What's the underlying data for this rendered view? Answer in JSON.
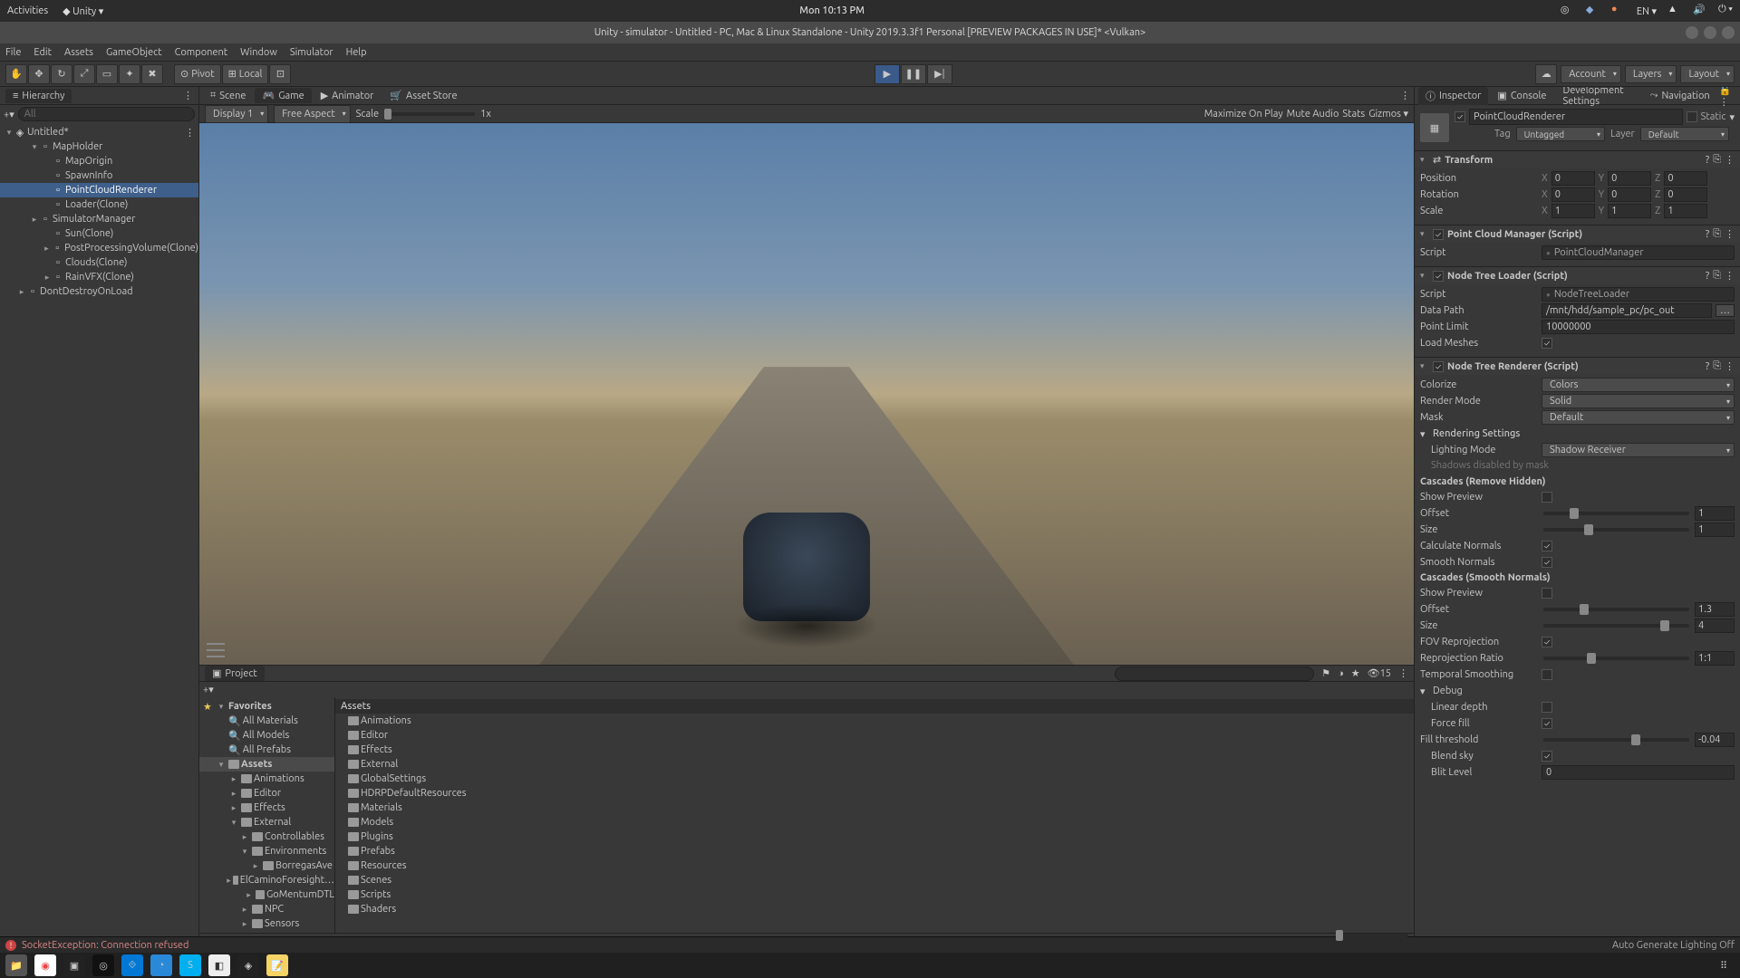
{
  "os_topbar": {
    "activities": "Activities",
    "app": "Unity",
    "clock": "Mon 10:13 PM",
    "lang": "EN"
  },
  "window_title": "Unity - simulator - Untitled - PC, Mac & Linux Standalone - Unity 2019.3.3f1 Personal [PREVIEW PACKAGES IN USE]* <Vulkan>",
  "menubar": [
    "File",
    "Edit",
    "Assets",
    "GameObject",
    "Component",
    "Window",
    "Simulator",
    "Help"
  ],
  "toolbar": {
    "pivot": "Pivot",
    "local": "Local",
    "account": "Account",
    "layers": "Layers",
    "layout": "Layout"
  },
  "hierarchy": {
    "title": "Hierarchy",
    "search_placeholder": "All",
    "scene": "Untitled*",
    "items": [
      {
        "name": "MapHolder",
        "depth": 1,
        "fold": "▾"
      },
      {
        "name": "MapOrigin",
        "depth": 2
      },
      {
        "name": "SpawnInfo",
        "depth": 2
      },
      {
        "name": "PointCloudRenderer",
        "depth": 2,
        "selected": true
      },
      {
        "name": "Loader(Clone)",
        "depth": 2
      },
      {
        "name": "SimulatorManager",
        "depth": 1,
        "fold": "▸"
      },
      {
        "name": "Sun(Clone)",
        "depth": 2
      },
      {
        "name": "PostProcessingVolume(Clone)",
        "depth": 2,
        "fold": "▸"
      },
      {
        "name": "Clouds(Clone)",
        "depth": 2
      },
      {
        "name": "RainVFX(Clone)",
        "depth": 2,
        "fold": "▸"
      },
      {
        "name": "DontDestroyOnLoad",
        "depth": 0,
        "fold": "▸"
      }
    ]
  },
  "scene_tabs": {
    "scene": "Scene",
    "game": "Game",
    "animator": "Animator",
    "asset_store": "Asset Store"
  },
  "scene_toolbar": {
    "display": "Display 1",
    "aspect": "Free Aspect",
    "scale_label": "Scale",
    "scale_val": "1x",
    "maximize": "Maximize On Play",
    "mute": "Mute Audio",
    "stats": "Stats",
    "gizmos": "Gizmos"
  },
  "project": {
    "title": "Project",
    "favorites_label": "Favorites",
    "favorites": [
      "All Materials",
      "All Models",
      "All Prefabs"
    ],
    "assets_label": "Assets",
    "tree": [
      {
        "name": "Animations",
        "depth": 1,
        "fold": "▸"
      },
      {
        "name": "Editor",
        "depth": 1,
        "fold": "▸"
      },
      {
        "name": "Effects",
        "depth": 1,
        "fold": "▸"
      },
      {
        "name": "External",
        "depth": 1,
        "fold": "▾"
      },
      {
        "name": "Controllables",
        "depth": 2,
        "fold": "▸"
      },
      {
        "name": "Environments",
        "depth": 2,
        "fold": "▾"
      },
      {
        "name": "BorregasAve",
        "depth": 3,
        "fold": "▸"
      },
      {
        "name": "ElCaminoForesight…",
        "depth": 3,
        "fold": "▸"
      },
      {
        "name": "GoMentumDTL",
        "depth": 3,
        "fold": "▸"
      },
      {
        "name": "NPC",
        "depth": 2,
        "fold": "▸"
      },
      {
        "name": "Sensors",
        "depth": 2,
        "fold": "▸"
      }
    ],
    "list_header": "Assets",
    "list": [
      "Animations",
      "Editor",
      "Effects",
      "External",
      "GlobalSettings",
      "HDRPDefaultResources",
      "Materials",
      "Models",
      "Plugins",
      "Prefabs",
      "Resources",
      "Scenes",
      "Scripts",
      "Shaders"
    ],
    "count": "15"
  },
  "inspector": {
    "tabs": {
      "inspector": "Inspector",
      "console": "Console",
      "dev": "Development Settings",
      "nav": "Navigation"
    },
    "object_name": "PointCloudRenderer",
    "static_label": "Static",
    "tag_label": "Tag",
    "tag_value": "Untagged",
    "layer_label": "Layer",
    "layer_value": "Default",
    "transform": {
      "title": "Transform",
      "position": "Position",
      "rotation": "Rotation",
      "scale": "Scale",
      "px": "0",
      "py": "0",
      "pz": "0",
      "rx": "0",
      "ry": "0",
      "rz": "0",
      "sx": "1",
      "sy": "1",
      "sz": "1"
    },
    "pcm": {
      "title": "Point Cloud Manager (Script)",
      "script_label": "Script",
      "script_value": "PointCloudManager"
    },
    "ntl": {
      "title": "Node Tree Loader (Script)",
      "script_label": "Script",
      "script_value": "NodeTreeLoader",
      "data_path_label": "Data Path",
      "data_path_value": "/mnt/hdd/sample_pc/pc_out",
      "point_limit_label": "Point Limit",
      "point_limit_value": "10000000",
      "load_meshes_label": "Load Meshes"
    },
    "ntr": {
      "title": "Node Tree Renderer (Script)",
      "colorize_label": "Colorize",
      "colorize_value": "Colors",
      "render_mode_label": "Render Mode",
      "render_mode_value": "Solid",
      "mask_label": "Mask",
      "mask_value": "Default",
      "rendering_settings": "Rendering Settings",
      "lighting_mode_label": "Lighting Mode",
      "lighting_mode_value": "Shadow Receiver",
      "shadows_disabled": "Shadows disabled by mask",
      "cascades_hidden": "Cascades (Remove Hidden)",
      "show_preview": "Show Preview",
      "offset": "Offset",
      "offset_val": "1",
      "size": "Size",
      "size_val": "1",
      "calc_normals": "Calculate Normals",
      "smooth_normals": "Smooth Normals",
      "cascades_smooth": "Cascades (Smooth Normals)",
      "offset2_val": "1.3",
      "size2_val": "4",
      "fov_reproj": "FOV Reprojection",
      "reproj_ratio": "Reprojection Ratio",
      "reproj_ratio_val": "1:1",
      "temporal": "Temporal Smoothing",
      "debug": "Debug",
      "linear_depth": "Linear depth",
      "force_fill": "Force fill",
      "fill_threshold": "Fill threshold",
      "fill_threshold_val": "-0.04",
      "blend_sky": "Blend sky",
      "blit_level": "Blit Level",
      "blit_level_val": "0"
    }
  },
  "statusbar": {
    "error": "SocketException: Connection refused",
    "auto_gen": "Auto Generate Lighting Off"
  }
}
